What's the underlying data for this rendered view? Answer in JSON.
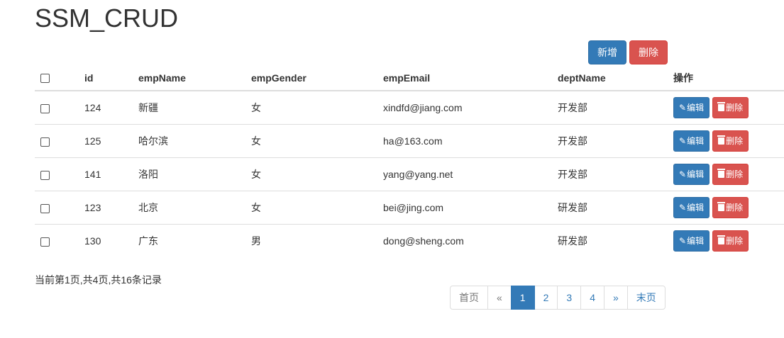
{
  "header": {
    "title": "SSM_CRUD"
  },
  "toolbar": {
    "add_label": "新增",
    "delete_label": "删除"
  },
  "table": {
    "columns": [
      "id",
      "empName",
      "empGender",
      "empEmail",
      "deptName",
      "操作"
    ],
    "rows": [
      {
        "id": "124",
        "name": "新疆",
        "gender": "女",
        "email": "xindfd@jiang.com",
        "dept": "开发部"
      },
      {
        "id": "125",
        "name": "哈尔滨",
        "gender": "女",
        "email": "ha@163.com",
        "dept": "开发部"
      },
      {
        "id": "141",
        "name": "洛阳",
        "gender": "女",
        "email": "yang@yang.net",
        "dept": "开发部"
      },
      {
        "id": "123",
        "name": "北京",
        "gender": "女",
        "email": "bei@jing.com",
        "dept": "研发部"
      },
      {
        "id": "130",
        "name": "广东",
        "gender": "男",
        "email": "dong@sheng.com",
        "dept": "研发部"
      }
    ],
    "edit_label": "编辑",
    "delete_label": "删除"
  },
  "pagination": {
    "info": "当前第1页,共4页,共16条记录",
    "first": "首页",
    "prev": "«",
    "pages": [
      "1",
      "2",
      "3",
      "4"
    ],
    "current": "1",
    "next": "»",
    "last": "末页"
  },
  "colors": {
    "primary": "#337ab7",
    "danger": "#d9534f"
  },
  "icons": {
    "edit": "pencil-icon",
    "delete": "trash-icon"
  }
}
